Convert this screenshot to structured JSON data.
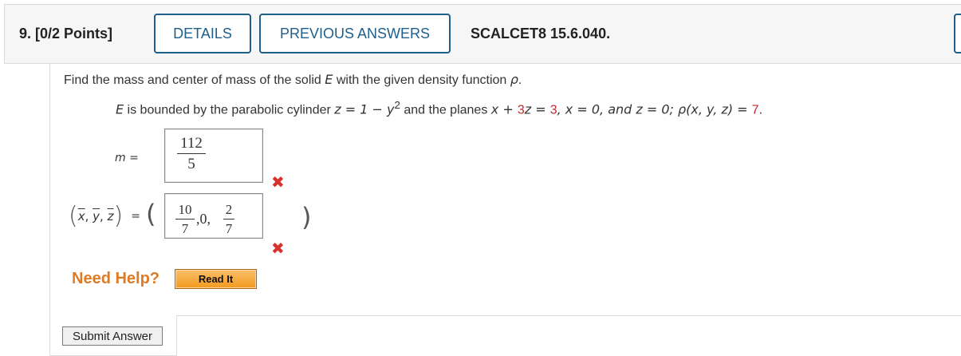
{
  "header": {
    "question_title": "9. [0/2 Points]",
    "details_label": "DETAILS",
    "previous_answers_label": "PREVIOUS ANSWERS",
    "course_code": "SCALCET8 15.6.040."
  },
  "problem": {
    "prompt_pre": "Find the mass and center of mass of the solid ",
    "prompt_var": "E",
    "prompt_post": " with the given density function ",
    "prompt_rho": "ρ",
    "prompt_end": ".",
    "stmt_E": "E",
    "stmt_part1": " is bounded by the parabolic cylinder  ",
    "stmt_cyl": "z = 1 − y",
    "stmt_cyl_exp": "2",
    "stmt_part2": "  and the planes  ",
    "stmt_plane_a": "x + ",
    "stmt_plane_b": "3",
    "stmt_plane_c": "z = ",
    "stmt_plane_d": "3",
    "stmt_plane_e": ",   x = 0,  and  z = 0;   ρ(x, y, z) = ",
    "stmt_density": "7",
    "stmt_end": "."
  },
  "answers": {
    "mass_label": "m =",
    "mass_num": "112",
    "mass_den": "5",
    "centroid_x": "x",
    "centroid_y": "y",
    "centroid_z": "z",
    "centroid_eq": "=",
    "c1_num": "10",
    "c1_den": "7",
    "c_mid": ",0,",
    "c2_num": "2",
    "c2_den": "7",
    "wrong_mark": "✖"
  },
  "help": {
    "need_help_label": "Need Help?",
    "read_it_label": "Read It"
  },
  "footer": {
    "submit_label": "Submit Answer"
  },
  "colors": {
    "accent_blue": "#1f5f8b",
    "wrong_red": "#d9322e",
    "help_orange": "#e07b24"
  }
}
